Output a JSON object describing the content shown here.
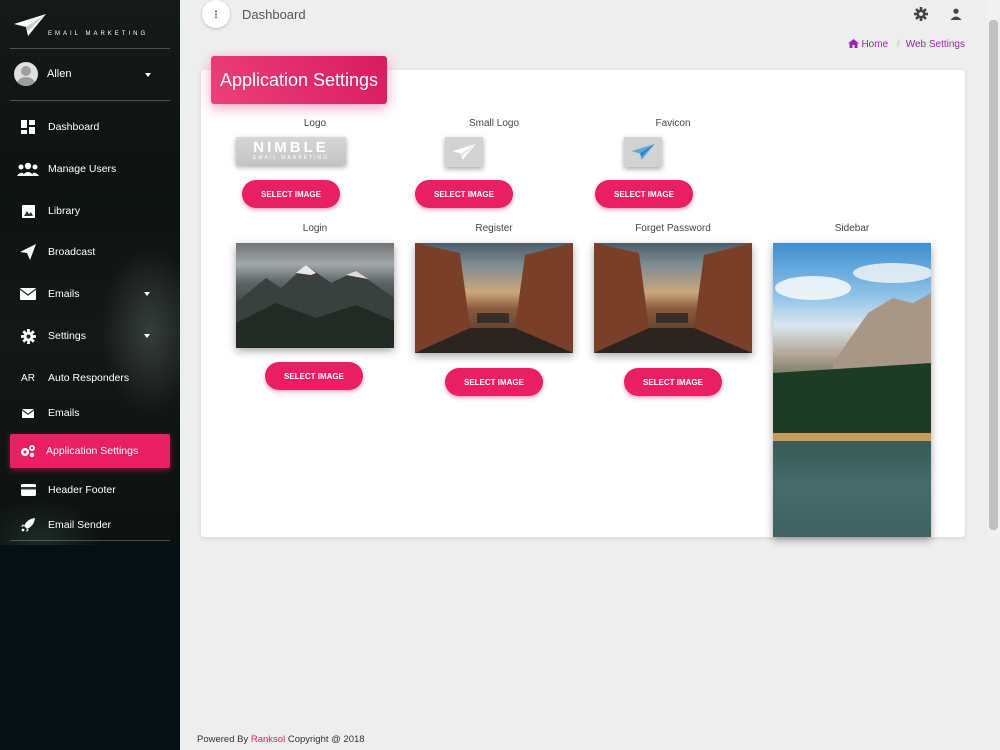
{
  "brand": {
    "text": "EMAIL MARKETING"
  },
  "user": {
    "name": "Allen"
  },
  "nav": [
    {
      "label": "Dashboard",
      "icon": "dashboard-icon"
    },
    {
      "label": "Manage Users",
      "icon": "users-icon"
    },
    {
      "label": "Library",
      "icon": "image-icon"
    },
    {
      "label": "Broadcast",
      "icon": "send-icon"
    },
    {
      "label": "Emails",
      "icon": "mail-icon"
    },
    {
      "label": "Settings",
      "icon": "gear-icon"
    },
    {
      "label": "Auto Responders",
      "icon_text": "AR"
    },
    {
      "label": "Emails",
      "icon": "mail-icon"
    },
    {
      "label": "Application Settings",
      "icon": "gears-icon"
    },
    {
      "label": "Header Footer",
      "icon": "credit-card-icon"
    },
    {
      "label": "Email Sender",
      "icon": "rocket-icon"
    }
  ],
  "topbar": {
    "title": "Dashboard"
  },
  "breadcrumb": {
    "home": "Home",
    "current": "Web Settings"
  },
  "card": {
    "title": "Application Settings"
  },
  "images": {
    "logo": {
      "label": "Logo",
      "logo_big": "NIMBLE",
      "logo_small": "EMAIL MARKETING"
    },
    "small_logo": {
      "label": "Small Logo"
    },
    "favicon": {
      "label": "Favicon"
    },
    "login": {
      "label": "Login"
    },
    "register": {
      "label": "Register"
    },
    "forget_password": {
      "label": "Forget Password"
    },
    "sidebar": {
      "label": "Sidebar"
    }
  },
  "select_button_label": "SELECT IMAGE",
  "footer": {
    "prefix": "Powered By",
    "brand": "Ranksol",
    "suffix": "Copyright @ 2018"
  },
  "colors": {
    "accent": "#e91e63",
    "breadcrumb": "#9c27b0"
  }
}
